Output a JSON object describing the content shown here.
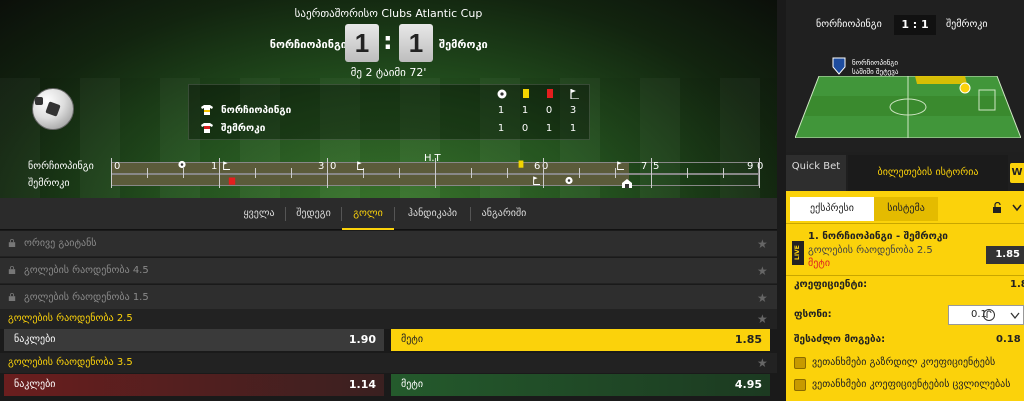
{
  "competition": "საერთაშორისო Clubs Atlantic Cup",
  "match": {
    "home": "ნორჩიოპინგი",
    "away": "შემროკი",
    "score_home": "1",
    "score_away": "1",
    "time": "მე 2 ტაიმი 72'"
  },
  "stats": {
    "rows": [
      {
        "team": "ნორჩიოპინგი",
        "goals": "1",
        "yellow": "1",
        "red": "0",
        "corners": "3"
      },
      {
        "team": "შემროკი",
        "goals": "1",
        "yellow": "0",
        "red": "1",
        "corners": "1"
      }
    ]
  },
  "timeline": {
    "home": "ნორჩიოპინგი",
    "away": "შემროკი",
    "ticks": [
      "0",
      "1",
      "5",
      "3",
      "0",
      "H.T",
      "6",
      "0",
      "7",
      "5",
      "9",
      "0"
    ],
    "progress_minutes": 72,
    "total_minutes": 90
  },
  "tabs": [
    "ყველა",
    "შედეგი",
    "გოლი",
    "ჰანდიკაპი",
    "ანგარიში"
  ],
  "active_tab": "გოლი",
  "markets": {
    "locked": [
      "ორივე გაიტანს",
      "გოლების რაოდენობა 4.5",
      "გოლების რაოდენობა 1.5"
    ],
    "m1": {
      "title": "გოლების რაოდენობა 2.5",
      "under_label": "ნაკლები",
      "under_odd": "1.90",
      "over_label": "მეტი",
      "over_odd": "1.85"
    },
    "m2": {
      "title": "გოლების რაოდენობა 3.5",
      "under_label": "ნაკლები",
      "under_odd": "1.14",
      "over_label": "მეტი",
      "over_odd": "4.95"
    }
  },
  "right": {
    "home": "ნორჩიოპინგი",
    "score": "1 : 1",
    "away": "შემროკი",
    "pitch_label_1": "ნორჩიოპინგი",
    "pitch_label_2": "საშიში შეტევა",
    "quick_bet": "Quick Bet",
    "ticket_history": "ბილეთების ისტორია",
    "w_label": "W",
    "slip_tabs": [
      "ექსპრესი",
      "სისტემა"
    ],
    "selection": "1. ნორჩიოპინგი - შემროკი",
    "selection_market": "გოლების რაოდენობა 2.5",
    "selection_pick": "მეტი",
    "selection_odd": "1.85",
    "live": "LIVE",
    "coef_label": "კოეფიციენტი:",
    "coef_value": "1.8",
    "stake_label": "ფსონი:",
    "stake_value": "0.1",
    "win_label": "შესაძლო მოგება:",
    "win_value": "0.18",
    "opt1": "ვეთანხმები გაზრდილ კოეფიციენტებს",
    "opt2": "ვეთანხმები კოეფიციენტების ცვლილებას"
  },
  "colors": {
    "accent": "#fbd20b",
    "over_bg": "#fbd20b",
    "under2_bg": "#5a1e1e",
    "over2_bg": "#1f4a26"
  }
}
